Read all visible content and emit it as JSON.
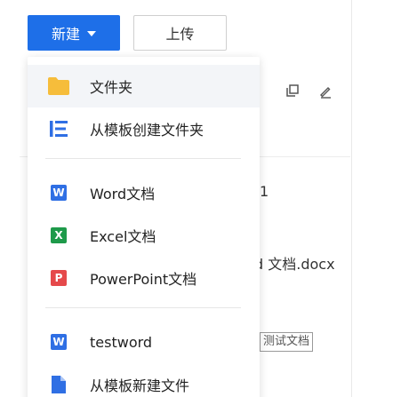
{
  "toolbar": {
    "new_label": "新建",
    "upload_label": "上传"
  },
  "menu": {
    "items": [
      {
        "label": "文件夹",
        "icon": "folder-icon"
      },
      {
        "label": "从模板创建文件夹",
        "icon": "template-list-icon"
      },
      {
        "label": "Word文档",
        "icon": "word-icon",
        "badge": "W"
      },
      {
        "label": "Excel文档",
        "icon": "excel-icon",
        "badge": "X"
      },
      {
        "label": "PowerPoint文档",
        "icon": "powerpoint-icon",
        "badge": "P"
      },
      {
        "label": "testword",
        "icon": "word-icon",
        "badge": "W"
      },
      {
        "label": "从模板新建文件",
        "icon": "file-icon"
      }
    ]
  },
  "background": {
    "number_text": "1",
    "file_text": "d 文档.docx",
    "tag_text": "测试文档"
  },
  "colors": {
    "primary": "#1e6fe8",
    "folder": "#f6bd3b",
    "word": "#2f6fe4",
    "excel": "#1e9a4a",
    "powerpoint": "#e5494b"
  }
}
